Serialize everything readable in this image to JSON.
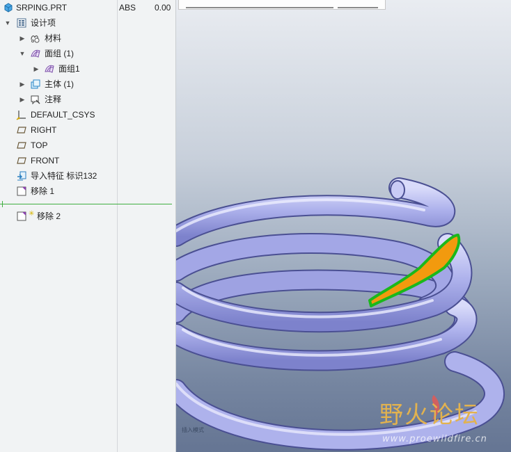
{
  "model_tree": {
    "header": {
      "title": "SRPING.PRT",
      "col1": "ABS",
      "col2": "0.00"
    },
    "items": [
      {
        "label": "设计项",
        "icon": "design-items-icon",
        "expander": "▼"
      },
      {
        "label": "材料",
        "icon": "material-icon",
        "expander": "▶"
      },
      {
        "label": "面组 (1)",
        "icon": "quilt-icon",
        "expander": "▼"
      },
      {
        "label": "面组1",
        "icon": "quilt-icon",
        "expander": "▶"
      },
      {
        "label": "主体 (1)",
        "icon": "body-icon",
        "expander": "▶"
      },
      {
        "label": "注释",
        "icon": "annotation-icon",
        "expander": "▶"
      },
      {
        "label": "DEFAULT_CSYS",
        "icon": "csys-icon",
        "expander": ""
      },
      {
        "label": "RIGHT",
        "icon": "datum-plane-icon",
        "expander": ""
      },
      {
        "label": "TOP",
        "icon": "datum-plane-icon",
        "expander": ""
      },
      {
        "label": "FRONT",
        "icon": "datum-plane-icon",
        "expander": ""
      },
      {
        "label": "导入特征 标识132",
        "icon": "import-feature-icon",
        "expander": ""
      },
      {
        "label": "移除 1",
        "icon": "remove-feature-icon",
        "expander": ""
      },
      {
        "label": "移除 2",
        "icon": "remove-feature-icon",
        "expander": ""
      }
    ]
  },
  "viewport": {
    "mode_label": "插入模式",
    "watermark": {
      "title": "野火论坛",
      "url": "www.proewildfire.cn"
    }
  },
  "colors": {
    "spring": "#aeb2ec",
    "spring_dark": "#6468b8",
    "highlight_fill": "#f29a0e",
    "highlight_outline": "#1bb81b",
    "insert_line": "#3fae3f"
  }
}
